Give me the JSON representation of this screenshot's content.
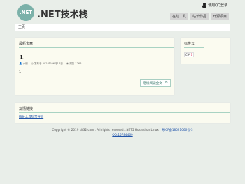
{
  "header": {
    "logo_text": ".NET",
    "site_title": ".NET技术栈",
    "qq_login": "使用QQ登录",
    "nav": [
      "在线工具",
      "站长作品",
      "开源项目"
    ]
  },
  "breadcrumb": "主页",
  "latest": {
    "heading": "最新文章",
    "post_title": "1",
    "author": "小编",
    "published": "发布于 2024年06月17日",
    "views": "浏览 1266",
    "body": "1",
    "read_more": "继续阅读全文"
  },
  "tags": {
    "heading": "标签云",
    "items": [
      {
        "name": "C#",
        "count": "1"
      }
    ]
  },
  "friends": {
    "heading": "友情链接",
    "links": [
      "碳链工具综合导航"
    ]
  },
  "footer": {
    "copyright": "Copyright © 2019 sit32.com . All rights reserved. .NET5 Hosted on Linux .",
    "beian": "粤ICP备18021066号-3",
    "qq": "QQ:15784469"
  }
}
